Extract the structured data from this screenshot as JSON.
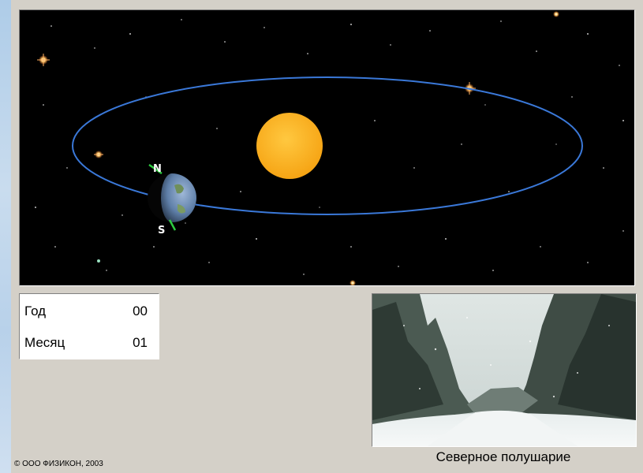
{
  "counters": {
    "year_label": "Год",
    "year_value": "00",
    "month_label": "Месяц",
    "month_value": "01"
  },
  "poles": {
    "north": "N",
    "south": "S"
  },
  "hemisphere_caption": "Северное полушарие",
  "copyright": "© ООО ФИЗИКОН, 2003",
  "colors": {
    "space": "#000000",
    "orbit": "#3a78d8",
    "sun": "#ffb020",
    "axis": "#2ecc40",
    "panel": "#d4d0c8"
  },
  "icons": {
    "sun": "sun-icon",
    "earth": "earth-icon"
  }
}
